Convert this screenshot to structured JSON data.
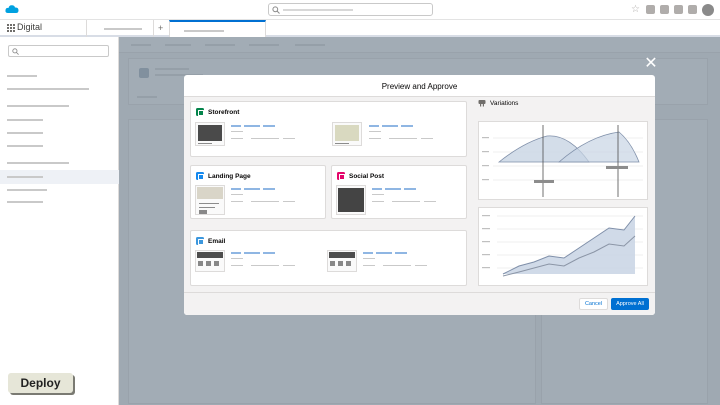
{
  "app": {
    "name": "Digital"
  },
  "icons": {
    "logo": "salesforce-cloud-icon",
    "launcher": "app-launcher-icon",
    "search": "search-icon",
    "close": "close-icon",
    "storefront": "storefront-icon",
    "landing": "landing-page-icon",
    "social": "social-post-icon",
    "email": "email-icon",
    "variations": "variations-icon"
  },
  "modal": {
    "title": "Preview and Approve",
    "close_symbol": "✕",
    "sections": {
      "storefront": "Storefront",
      "landing": "Landing Page",
      "social": "Social Post",
      "email": "Email",
      "variations": "Variations"
    },
    "cancel_label": "Cancel",
    "approve_label": "Approve All"
  },
  "colors": {
    "brand_blue": "#0070d2",
    "storefront_icon": "#04844b",
    "landing_icon": "#1589ee",
    "social_icon": "#e3066a",
    "email_icon": "#3c97dd",
    "chart_fill": "#c8d4e4",
    "chart_line": "#7f8fa9"
  },
  "deploy_label": "Deploy"
}
